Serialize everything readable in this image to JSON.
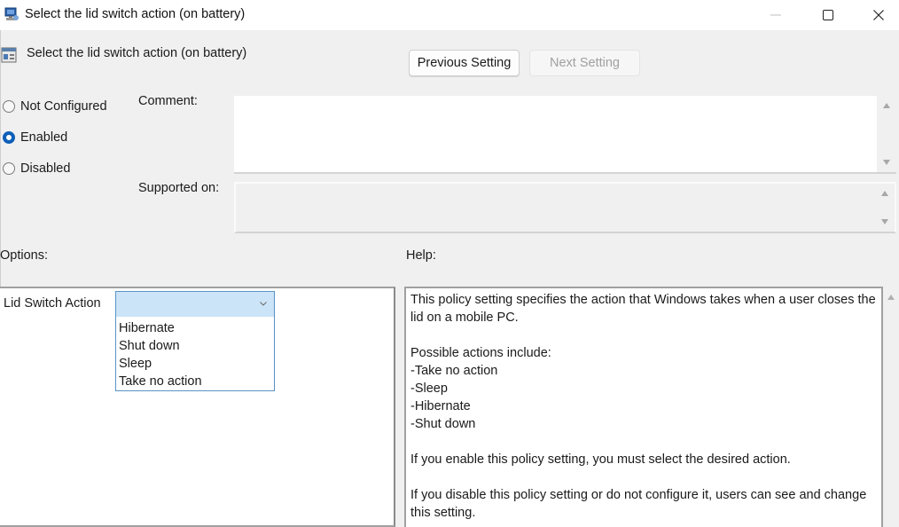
{
  "window": {
    "title": "Select the lid switch action (on battery)",
    "controls": {
      "minimize": "minimize",
      "maximize": "maximize",
      "close": "close"
    }
  },
  "header": {
    "policy_title": "Select the lid switch action (on battery)",
    "previous_label": "Previous Setting",
    "next_label": "Next Setting",
    "next_enabled": false
  },
  "state": {
    "options": [
      {
        "label": "Not Configured",
        "checked": false
      },
      {
        "label": "Enabled",
        "checked": true
      },
      {
        "label": "Disabled",
        "checked": false
      }
    ],
    "accent": "#0f5fb8"
  },
  "fields": {
    "comment_label": "Comment:",
    "comment_value": "",
    "supported_label": "Supported on:",
    "supported_value": ""
  },
  "sections": {
    "options_label": "Options:",
    "help_label": "Help:"
  },
  "options_pane": {
    "lid_label": "Lid Switch Action",
    "combo_value": "",
    "dropdown_items": [
      "Hibernate",
      "Shut down",
      "Sleep",
      "Take no action"
    ]
  },
  "help": {
    "p1": "This policy setting specifies the action that Windows takes when a user closes the lid on a mobile PC.",
    "list_title": "Possible actions include:",
    "list": [
      "-Take no action",
      "-Sleep",
      "-Hibernate",
      "-Shut down"
    ],
    "p2": "If you enable this policy setting, you must select the desired action.",
    "p3": "If you disable this policy setting or do not configure it, users can see and change this setting."
  }
}
